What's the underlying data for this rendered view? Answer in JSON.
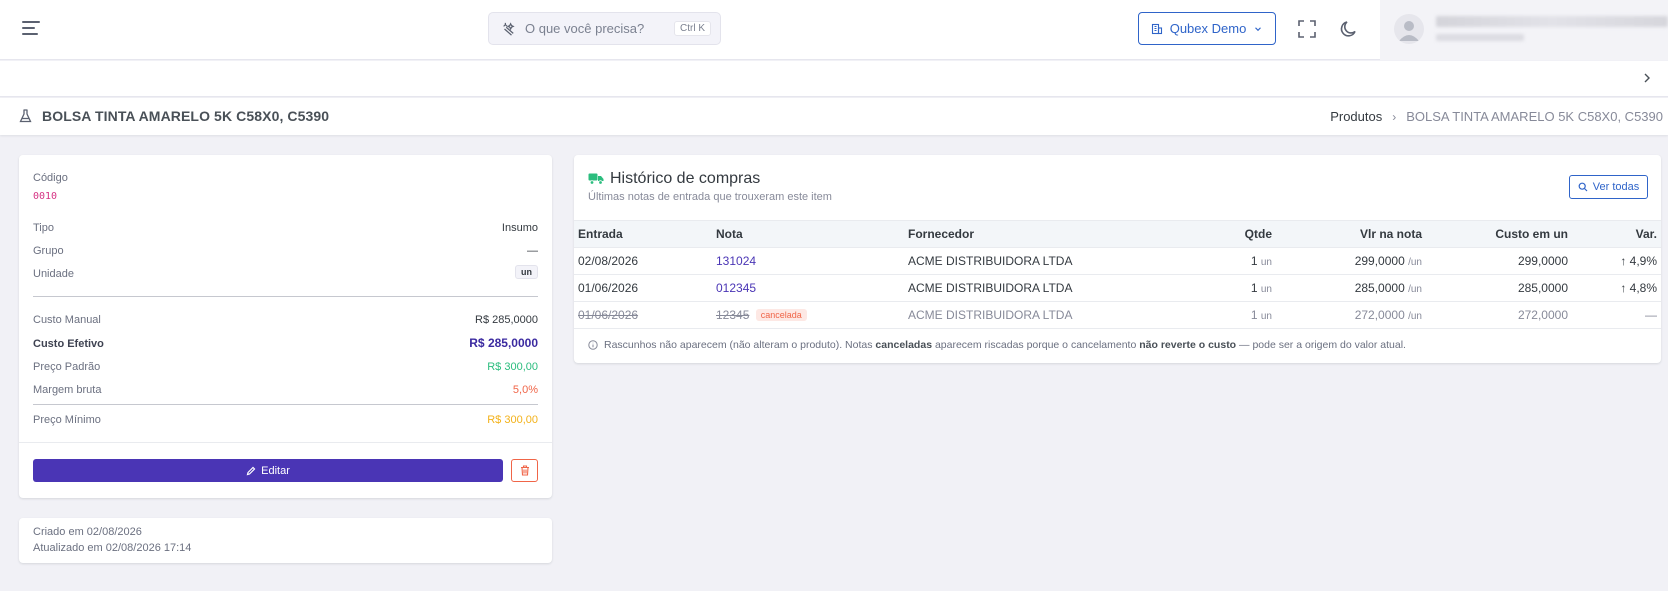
{
  "header": {
    "search_placeholder": "O que você precisa?",
    "search_shortcut": "Ctrl K",
    "tenant_label": "Qubex Demo"
  },
  "page": {
    "title": "BOLSA TINTA AMARELO 5K C58X0, C5390",
    "breadcrumb": [
      "Produtos",
      "BOLSA TINTA AMARELO 5K C58X0, C5390"
    ]
  },
  "product": {
    "code_label": "Código",
    "code_value": "0010",
    "tipo_label": "Tipo",
    "tipo_value": "Insumo",
    "grupo_label": "Grupo",
    "grupo_value": "—",
    "unidade_label": "Unidade",
    "unidade_value": "un",
    "custo_manual_label": "Custo Manual",
    "custo_manual_value": "R$ 285,0000",
    "custo_efetivo_label": "Custo Efetivo",
    "custo_efetivo_value": "R$ 285,0000",
    "preco_padrao_label": "Preço Padrão",
    "preco_padrao_value": "R$ 300,00",
    "margem_label": "Margem bruta",
    "margem_value": "5,0%",
    "preco_minimo_label": "Preço Mínimo",
    "preco_minimo_value": "R$ 300,00",
    "edit_label": "Editar"
  },
  "meta": {
    "created": "Criado em 02/08/2026",
    "updated": "Atualizado em 02/08/2026 17:14"
  },
  "history": {
    "title": "Histórico de compras",
    "subtitle": "Últimas notas de entrada que trouxeram este item",
    "ver_todas": "Ver todas",
    "columns": [
      "Entrada",
      "Nota",
      "Fornecedor",
      "Qtde",
      "Vlr na nota",
      "Custo em un",
      "Var."
    ],
    "rows": [
      {
        "entrada": "02/08/2026",
        "nota": "131024",
        "fornecedor": "ACME DISTRIBUIDORA LTDA",
        "qtde": "1",
        "qtde_unit": "un",
        "vlr": "299,0000",
        "vlr_unit": "/un",
        "custo": "299,0000",
        "var": "↑ 4,9%"
      },
      {
        "entrada": "01/06/2026",
        "nota": "012345",
        "fornecedor": "ACME DISTRIBUIDORA LTDA",
        "qtde": "1",
        "qtde_unit": "un",
        "vlr": "285,0000",
        "vlr_unit": "/un",
        "custo": "285,0000",
        "var": "↑ 4,8%"
      },
      {
        "entrada": "01/06/2026",
        "nota": "12345",
        "nota_badge": "cancelada",
        "fornecedor": "ACME DISTRIBUIDORA LTDA",
        "qtde": "1",
        "qtde_unit": "un",
        "vlr": "272,0000",
        "vlr_unit": "/un",
        "custo": "272,0000",
        "var": "—"
      }
    ],
    "note_part1": "Rascunhos não aparecem (não alteram o produto). Notas ",
    "note_bold1": "canceladas",
    "note_part2": " aparecem riscadas porque o cancelamento ",
    "note_bold2": "não reverte o custo",
    "note_part3": " — pode ser a origem do valor atual."
  },
  "colors": {
    "primary": "#4a35b5",
    "accent_blue": "#2f64c9",
    "danger": "#f06548",
    "success": "#2bbd7e",
    "warning": "#f3b21a"
  }
}
